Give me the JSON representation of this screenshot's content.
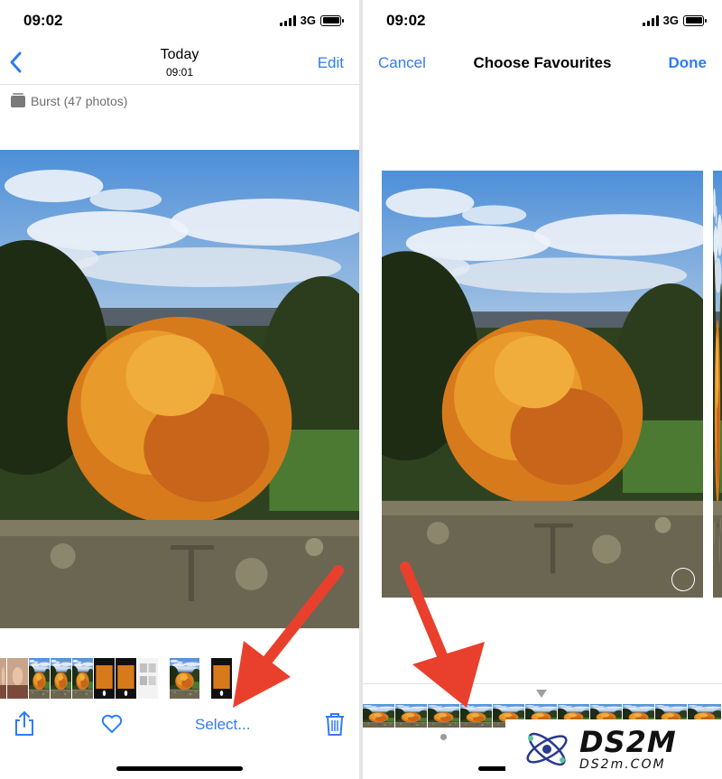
{
  "left": {
    "status": {
      "time": "09:02",
      "network": "3G"
    },
    "nav": {
      "title": "Today",
      "subtitle": "09:01",
      "edit_label": "Edit"
    },
    "burst_label": "Burst (47 photos)",
    "toolbar": {
      "select_label": "Select..."
    }
  },
  "right": {
    "status": {
      "time": "09:02",
      "network": "3G"
    },
    "nav": {
      "cancel_label": "Cancel",
      "title": "Choose Favourites",
      "done_label": "Done"
    }
  },
  "icons": {
    "back": "chevron-left-icon",
    "share": "share-icon",
    "favorite": "heart-icon",
    "delete": "trash-icon",
    "signal": "signal-icon",
    "battery": "battery-icon",
    "burst": "burst-stack-icon"
  },
  "colors": {
    "accent": "#2f7cf6",
    "arrow": "#e8402c"
  },
  "watermark": {
    "brand": "DS2M",
    "domain": "DS2m.COM"
  }
}
